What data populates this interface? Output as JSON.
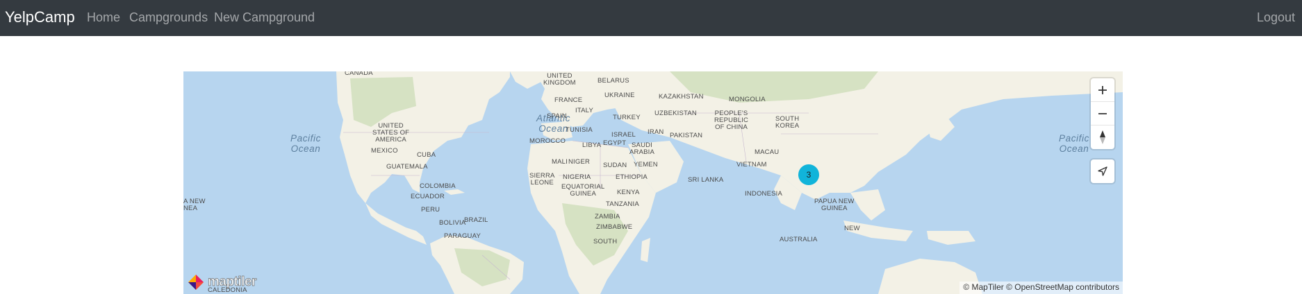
{
  "navbar": {
    "brand": "YelpCamp",
    "links": [
      "Home",
      "Campgrounds",
      "New Campground"
    ],
    "logout": "Logout"
  },
  "map": {
    "oceans": {
      "pacific_left": "Pacific\nOcean",
      "atlantic": "Atlantic\nOcean",
      "pacific_right": "Pacific\nOcean"
    },
    "labels": {
      "canada": "CANADA",
      "usa": "UNITED\nSTATES OF\nAMERICA",
      "mexico": "MEXICO",
      "cuba": "CUBA",
      "guatemala": "GUATEMALA",
      "colombia": "COLOMBIA",
      "ecuador": "ECUADOR",
      "peru": "PERU",
      "bolivia": "BOLIVIA",
      "brazil": "BRAZIL",
      "paraguay": "PARAGUAY",
      "uk": "UNITED\nKINGDOM",
      "france": "FRANCE",
      "spain": "SPAIN",
      "italy": "ITALY",
      "belarus": "BELARUS",
      "ukraine": "UKRAINE",
      "turkey": "TURKEY",
      "tunisia": "TUNISIA",
      "morocco": "MOROCCO",
      "libya": "LIBYA",
      "egypt": "EGYPT",
      "israel": "ISRAEL",
      "mali": "MALI",
      "niger": "NIGER",
      "sudan": "SUDAN",
      "sierra_leone": "SIERRA\nLEONE",
      "nigeria": "NIGERIA",
      "ethiopia": "ETHIOPIA",
      "eq_guinea": "EQUATORIAL\nGUINEA",
      "kenya": "KENYA",
      "tanzania": "TANZANIA",
      "zambia": "ZAMBIA",
      "zimbabwe": "ZIMBABWE",
      "south": "SOUTH",
      "saudi": "SAUDI\nARABIA",
      "yemen": "YEMEN",
      "iran": "IRAN",
      "pakistan": "PAKISTAN",
      "kazakhstan": "KAZAKHSTAN",
      "uzbekistan": "UZBEKISTAN",
      "mongolia": "MONGOLIA",
      "china": "PEOPLE'S\nREPUBLIC\nOF CHINA",
      "south_korea": "SOUTH\nKOREA",
      "macau": "MACAU",
      "vietnam": "VIETNAM",
      "sri_lanka": "SRI LANKA",
      "indonesia": "INDONESIA",
      "png": "PAPUA NEW\nGUINEA",
      "australia": "AUSTRALIA",
      "new": "NEW",
      "png_left": "A NEW\nNEA",
      "caledonia": "CALEDONIA"
    },
    "cluster_count": "3",
    "logo_text": "maptiler",
    "attribution": {
      "maptiler": "© MapTiler",
      "osm": "© OpenStreetMap contributors"
    },
    "colors": {
      "water": "#b7d5ef",
      "land": "#f3f1e6",
      "vegetation": "#d6e2c3",
      "cluster": "#11b4da",
      "navbar": "#343a40"
    }
  }
}
